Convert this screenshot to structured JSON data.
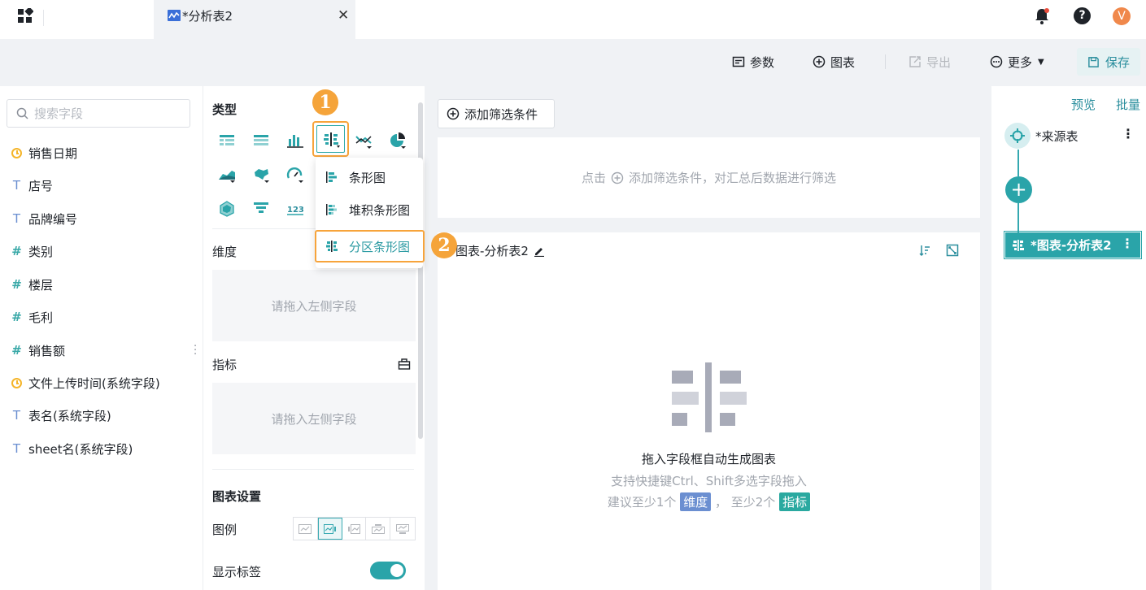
{
  "tabbar": {
    "tab_title": "*分析表2",
    "close_glyph": "✕",
    "help_glyph": "?",
    "avatar_letter": "V"
  },
  "toolbar": {
    "params": "参数",
    "chart": "图表",
    "export": "导出",
    "more": "更多",
    "more_caret": "▼",
    "save": "保存"
  },
  "fields": {
    "search_placeholder": "搜索字段",
    "items": [
      {
        "type": "date",
        "label": "销售日期"
      },
      {
        "type": "text",
        "glyph": "T",
        "label": "店号"
      },
      {
        "type": "text",
        "glyph": "T",
        "label": "品牌编号"
      },
      {
        "type": "number",
        "glyph": "#",
        "label": "类别"
      },
      {
        "type": "number",
        "glyph": "#",
        "label": "楼层"
      },
      {
        "type": "number",
        "glyph": "#",
        "label": "毛利"
      },
      {
        "type": "number",
        "glyph": "#",
        "label": "销售额"
      },
      {
        "type": "date",
        "label": "文件上传时间(系统字段)"
      },
      {
        "type": "text",
        "glyph": "T",
        "label": "表名(系统字段)"
      },
      {
        "type": "text",
        "glyph": "T",
        "label": "sheet名(系统字段)"
      }
    ]
  },
  "config": {
    "type_title": "类型",
    "dimension_title": "维度",
    "indicator_title": "指标",
    "drop_hint": "请拖入左侧字段",
    "chart_settings_title": "图表设置",
    "legend_label": "图例",
    "show_labels_label": "显示标签",
    "show_labels_on": true
  },
  "badges": {
    "one": "1",
    "two": "2"
  },
  "dropdown": {
    "items": [
      "条形图",
      "堆积条形图",
      "分区条形图"
    ],
    "highlighted": "分区条形图"
  },
  "main": {
    "add_filter": "添加筛选条件",
    "filter_hint_prefix": "点击",
    "filter_hint_suffix": "添加筛选条件，对汇总后数据进行筛选",
    "chart_title": "图表-分析表2",
    "empty_title": "拖入字段框自动生成图表",
    "empty_sub": "支持快捷键Ctrl、Shift多选字段拖入",
    "suggest_prefix": "建议至少1个",
    "dim_tag": "维度",
    "suggest_mid": "，  至少2个",
    "ind_tag": "指标"
  },
  "flow": {
    "preview": "预览",
    "batch": "批量",
    "source_node": "*来源表",
    "chart_node": "*图表-分析表2",
    "menu_glyph": "⋮",
    "add_glyph": "+"
  },
  "colors": {
    "accent": "#2aa4a9",
    "badge": "#f5a43a",
    "dimension_tag": "#6b8fd1",
    "indicator_tag": "#2aa9a0"
  }
}
